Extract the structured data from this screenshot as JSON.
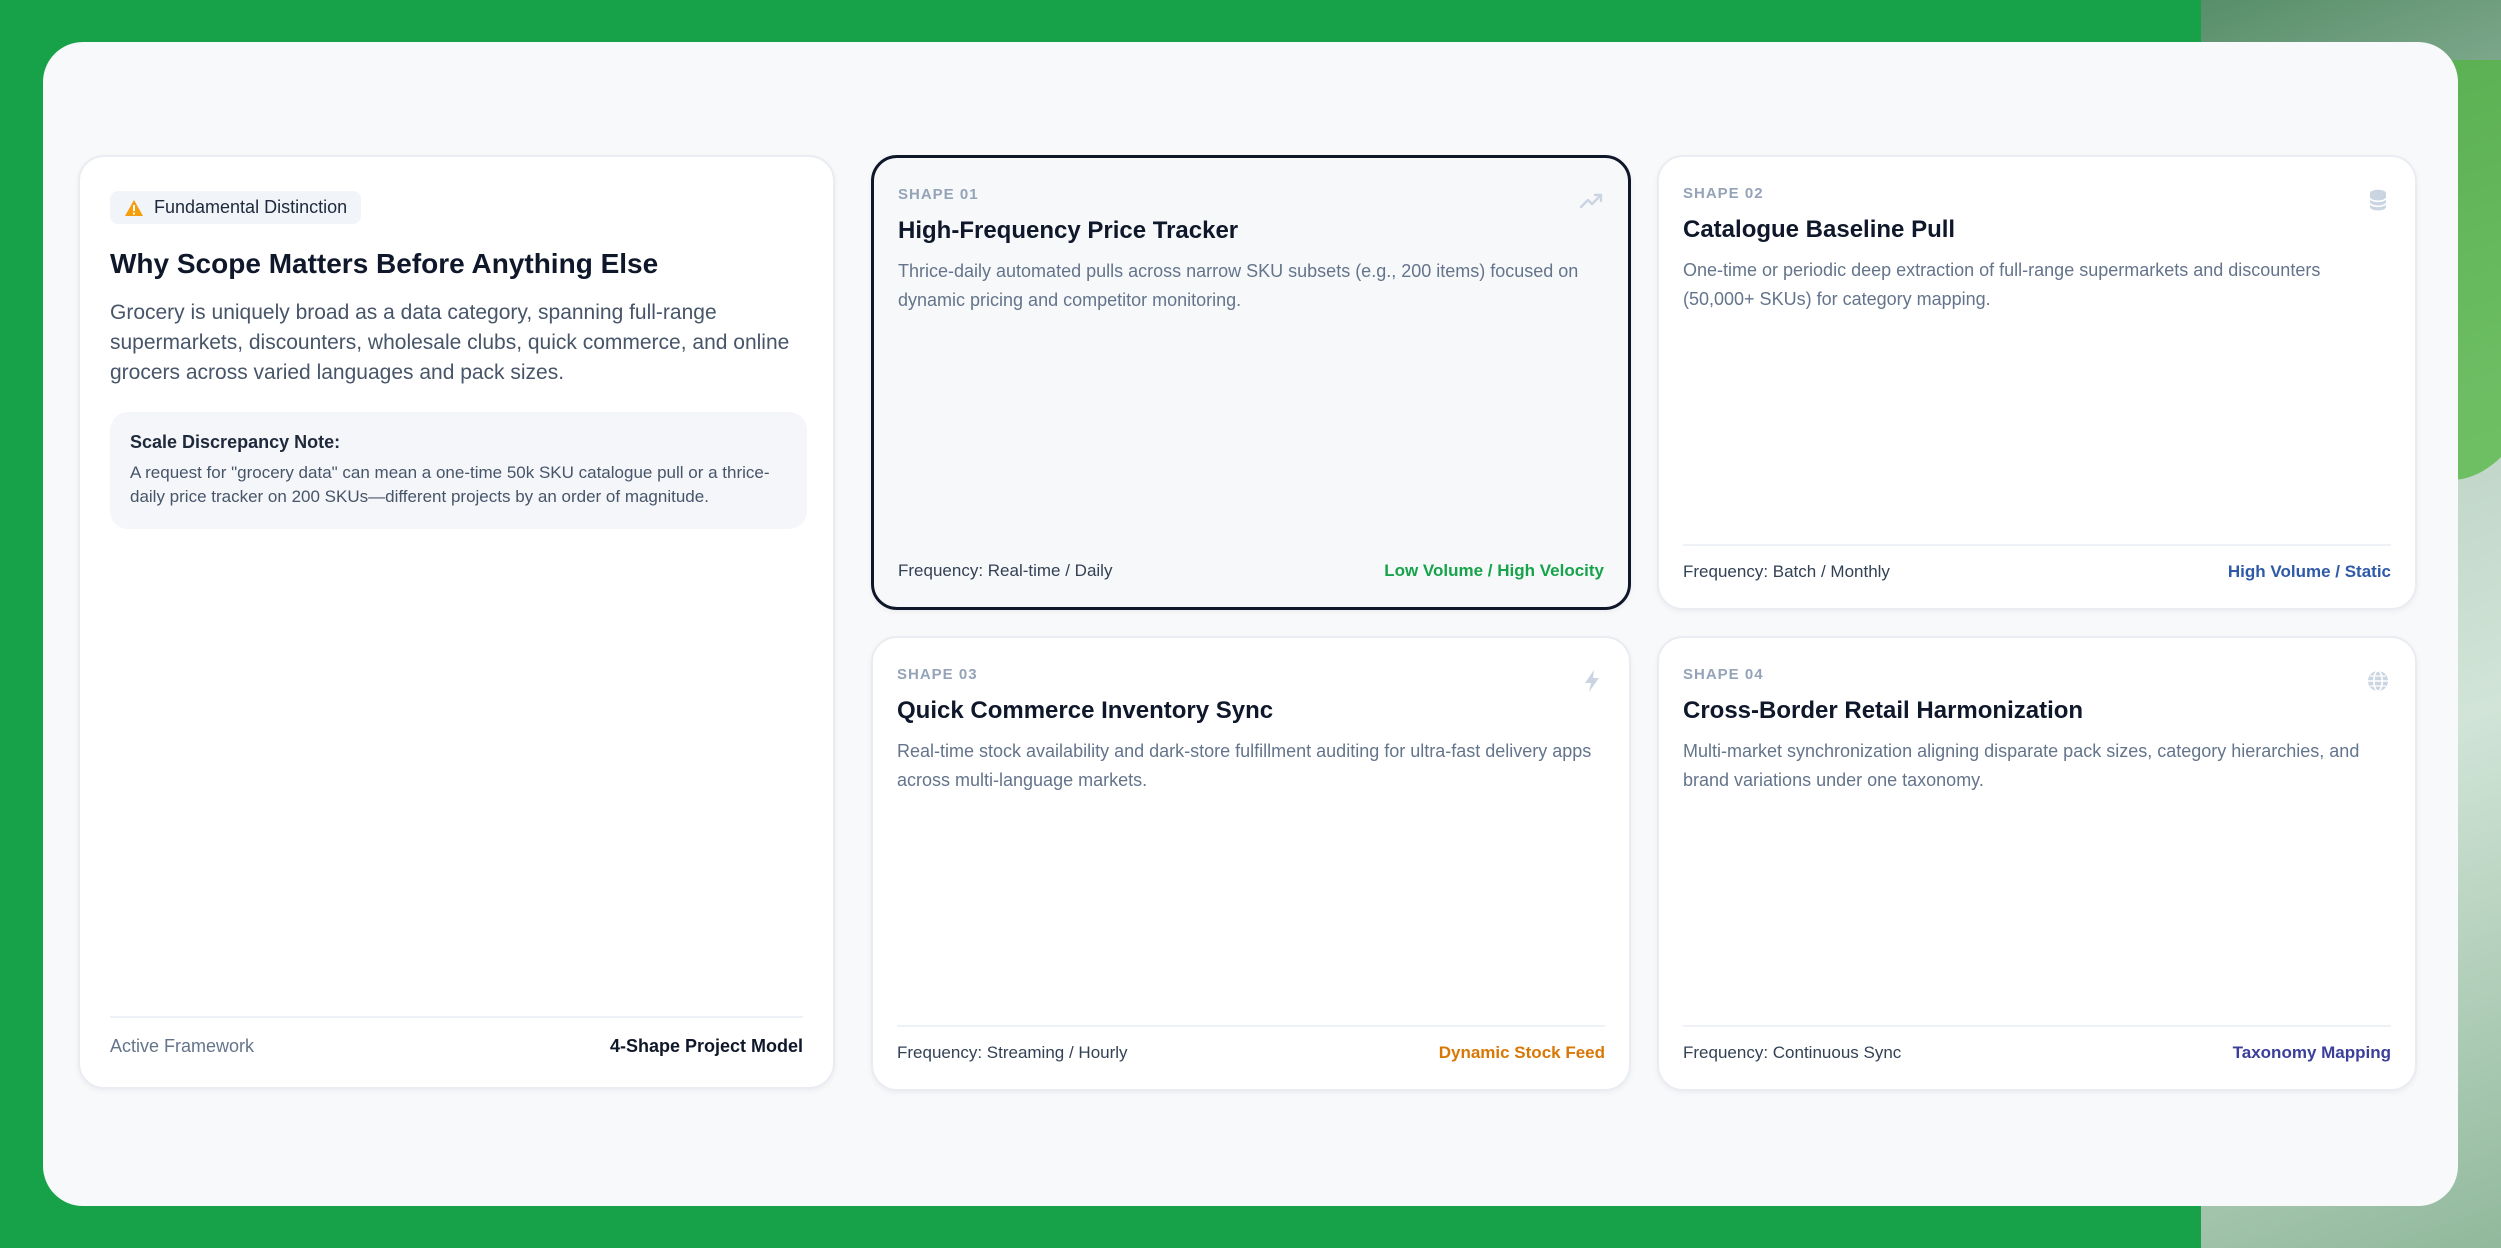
{
  "intro": {
    "badge": "Fundamental Distinction",
    "title": "Why Scope Matters Before Anything Else",
    "body": "Grocery is uniquely broad as a data category, spanning full-range supermarkets, discounters, wholesale clubs, quick commerce, and online grocers across varied languages and pack sizes.",
    "note_title": "Scale Discrepancy Note:",
    "note_body": "A request for \"grocery data\" can mean a one-time 50k SKU catalogue pull or a thrice-daily price tracker on 200 SKUs—different projects by an order of magnitude.",
    "footer_label": "Active Framework",
    "footer_value": "4-Shape Project Model"
  },
  "shapes": [
    {
      "label": "SHAPE 01",
      "title": "High-Frequency Price Tracker",
      "desc": "Thrice-daily automated pulls across narrow SKU subsets (e.g., 200 items) focused on dynamic pricing and competitor monitoring.",
      "frequency": "Frequency: Real-time / Daily",
      "tag": "Low Volume / High Velocity",
      "tag_color": "#16a34a",
      "icon": "trending-up-icon"
    },
    {
      "label": "SHAPE 02",
      "title": "Catalogue Baseline Pull",
      "desc": "One-time or periodic deep extraction of full-range supermarkets and discounters (50,000+ SKUs) for category mapping.",
      "frequency": "Frequency: Batch / Monthly",
      "tag": "High Volume / Static",
      "tag_color": "#2f5aa8",
      "icon": "database-icon"
    },
    {
      "label": "SHAPE 03",
      "title": "Quick Commerce Inventory Sync",
      "desc": "Real-time stock availability and dark-store fulfillment auditing for ultra-fast delivery apps across multi-language markets.",
      "frequency": "Frequency: Streaming / Hourly",
      "tag": "Dynamic Stock Feed",
      "tag_color": "#d97706",
      "icon": "lightning-icon"
    },
    {
      "label": "SHAPE 04",
      "title": "Cross-Border Retail Harmonization",
      "desc": "Multi-market synchronization aligning disparate pack sizes, category hierarchies, and brand variations under one taxonomy.",
      "frequency": "Frequency: Continuous Sync",
      "tag": "Taxonomy Mapping",
      "tag_color": "#3b3f9a",
      "icon": "globe-icon"
    }
  ]
}
